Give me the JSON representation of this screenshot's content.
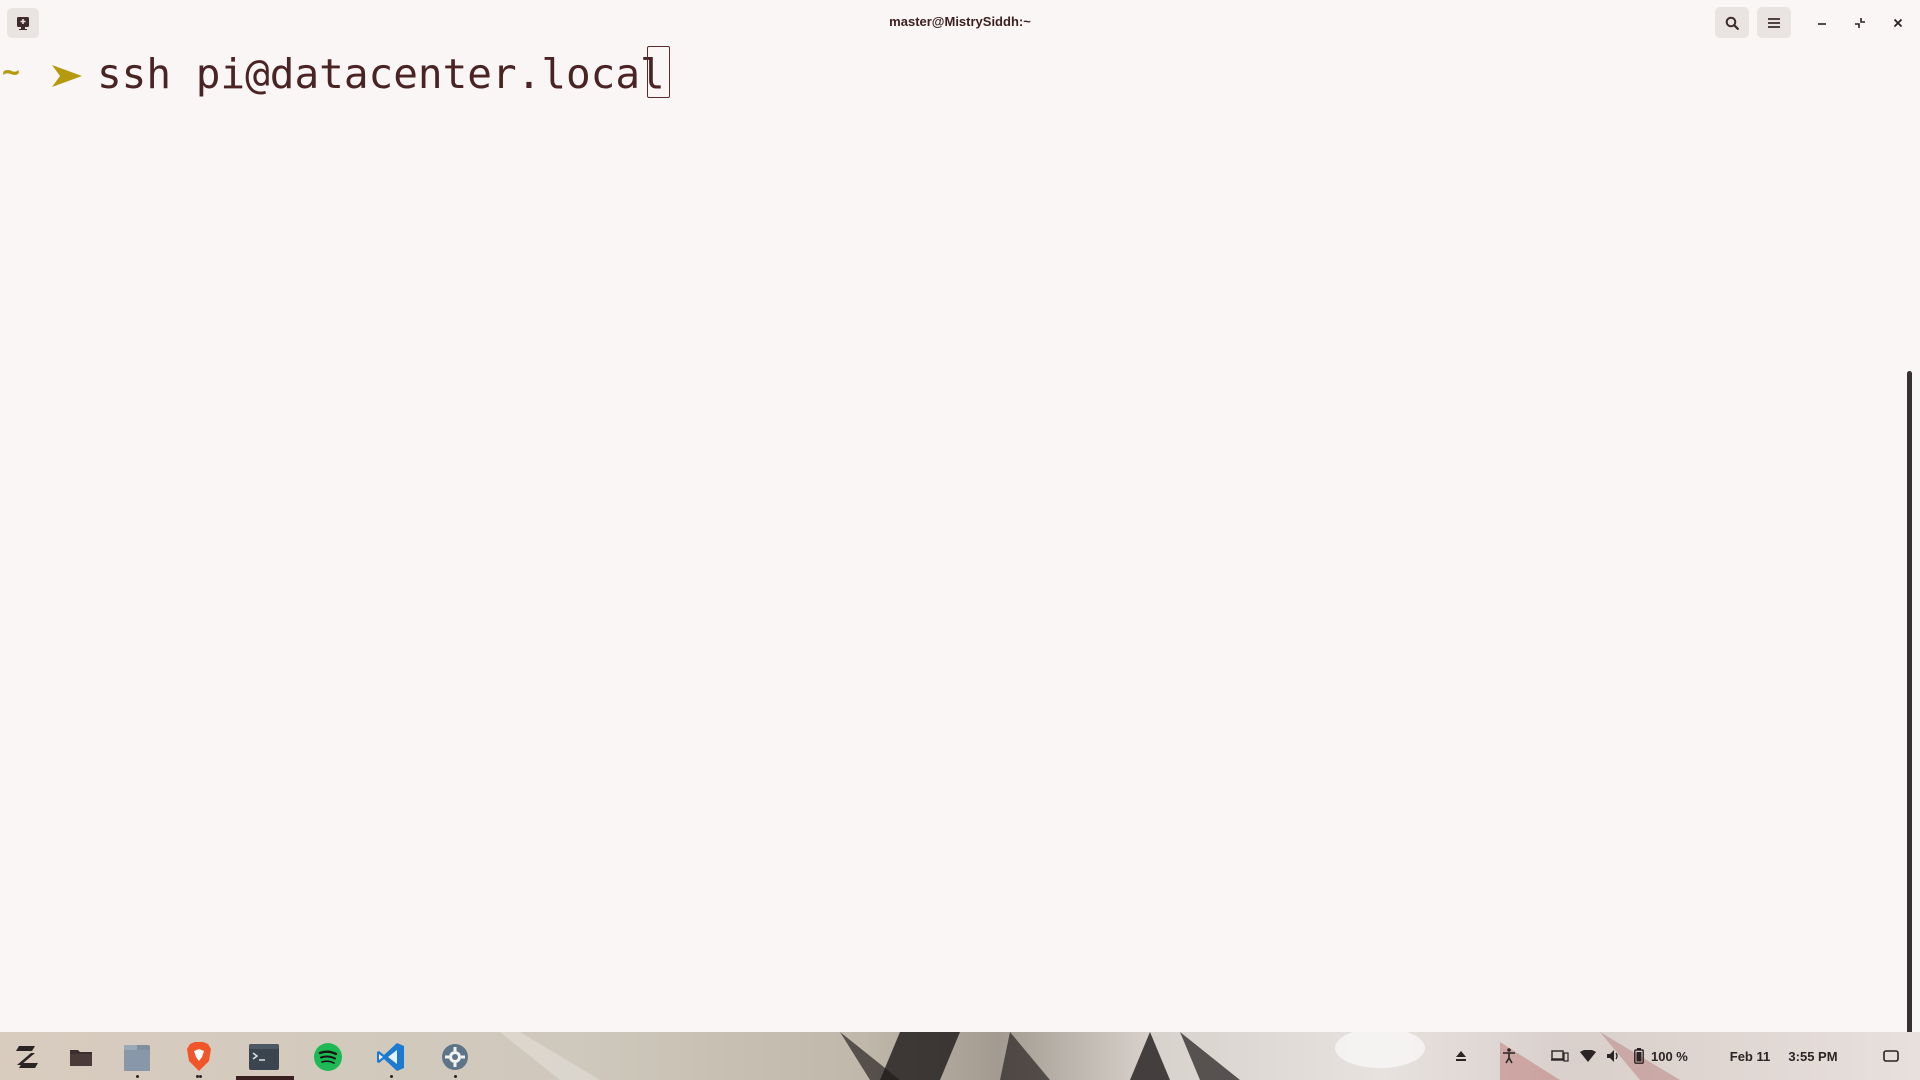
{
  "window": {
    "title": "master@MistrySiddh:~"
  },
  "terminal": {
    "prompt_symbol": "~",
    "command": "ssh pi@datacenter.local",
    "colors": {
      "background": "#faf6f5",
      "text": "#4a2424",
      "prompt_accent": "#b59a10"
    }
  },
  "taskbar": {
    "apps": [
      {
        "name": "Zorin menu",
        "icon": "zorin-logo-icon"
      },
      {
        "name": "Files",
        "icon": "folder-icon"
      },
      {
        "name": "File manager",
        "icon": "file-cabinet-icon"
      },
      {
        "name": "Brave",
        "icon": "brave-icon"
      },
      {
        "name": "Terminal",
        "icon": "terminal-icon"
      },
      {
        "name": "Spotify",
        "icon": "spotify-icon"
      },
      {
        "name": "Visual Studio Code",
        "icon": "vscode-icon"
      },
      {
        "name": "Settings",
        "icon": "settings-gear-icon"
      }
    ],
    "tray": {
      "battery_percent": "100 %",
      "date": "Feb 11",
      "time": "3:55 PM"
    }
  }
}
